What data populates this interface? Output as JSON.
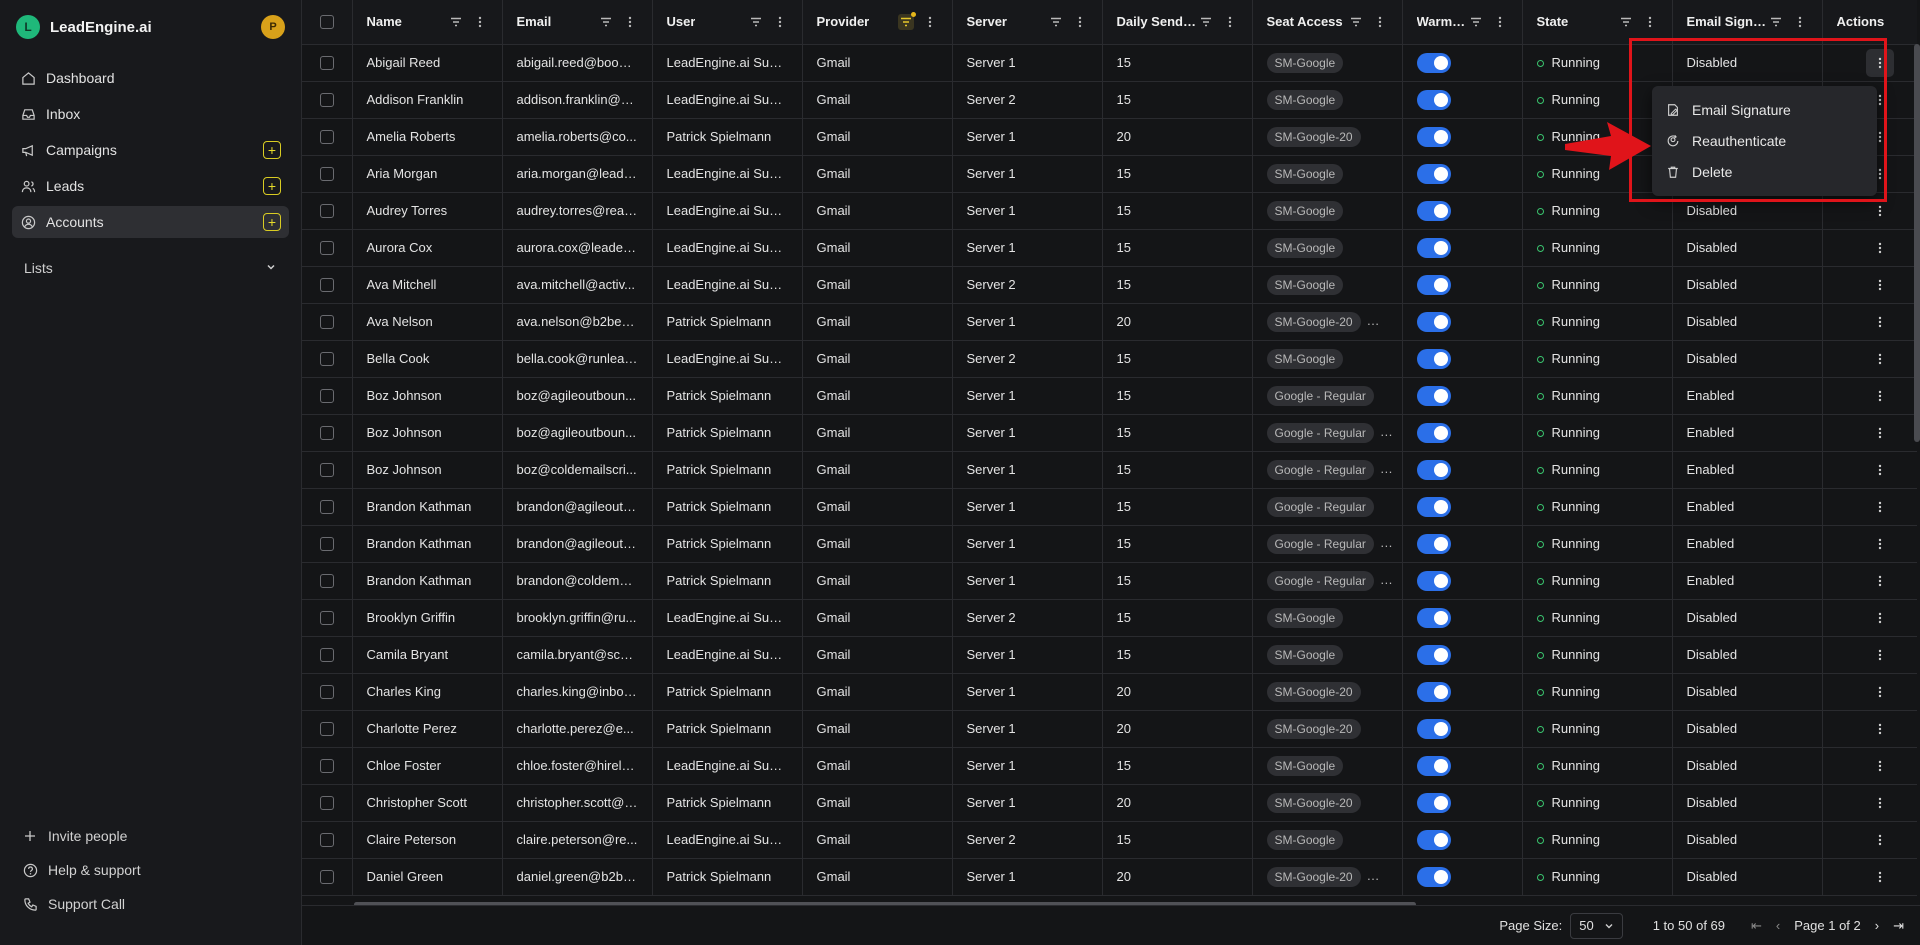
{
  "app": {
    "name": "LeadEngine.ai",
    "logo_letter": "L",
    "user_initial": "P"
  },
  "sidebar": {
    "items": [
      {
        "label": "Dashboard",
        "icon": "home-icon",
        "active": false,
        "plus": false
      },
      {
        "label": "Inbox",
        "icon": "inbox-icon",
        "active": false,
        "plus": false
      },
      {
        "label": "Campaigns",
        "icon": "megaphone-icon",
        "active": false,
        "plus": true
      },
      {
        "label": "Leads",
        "icon": "users-icon",
        "active": false,
        "plus": true
      },
      {
        "label": "Accounts",
        "icon": "account-icon",
        "active": true,
        "plus": true
      }
    ],
    "lists_label": "Lists",
    "bottom": [
      {
        "label": "Invite people",
        "icon": "plus-icon"
      },
      {
        "label": "Help & support",
        "icon": "help-icon"
      },
      {
        "label": "Support Call",
        "icon": "phone-icon"
      }
    ]
  },
  "table": {
    "columns": [
      "Name",
      "Email",
      "User",
      "Provider",
      "Server",
      "Daily Send Li...",
      "Seat Access",
      "WarmUp",
      "State",
      "Email Signat...",
      "Actions"
    ],
    "rows": [
      [
        "Abigail Reed",
        "abigail.reed@boost...",
        "LeadEngine.ai Supp...",
        "Gmail",
        "Server 1",
        "15",
        [
          "SM-Google"
        ],
        "Running",
        "Disabled"
      ],
      [
        "Addison Franklin",
        "addison.franklin@u...",
        "LeadEngine.ai Supp...",
        "Gmail",
        "Server 2",
        "15",
        [
          "SM-Google"
        ],
        "Running",
        "Disabled"
      ],
      [
        "Amelia Roberts",
        "amelia.roberts@co...",
        "Patrick Spielmann",
        "Gmail",
        "Server 1",
        "20",
        [
          "SM-Google-20"
        ],
        "Running",
        "Disabled"
      ],
      [
        "Aria Morgan",
        "aria.morgan@leade...",
        "LeadEngine.ai Supp...",
        "Gmail",
        "Server 1",
        "15",
        [
          "SM-Google"
        ],
        "Running",
        "Disabled"
      ],
      [
        "Audrey Torres",
        "audrey.torres@reac...",
        "LeadEngine.ai Supp...",
        "Gmail",
        "Server 1",
        "15",
        [
          "SM-Google"
        ],
        "Running",
        "Disabled"
      ],
      [
        "Aurora Cox",
        "aurora.cox@leaden...",
        "LeadEngine.ai Supp...",
        "Gmail",
        "Server 1",
        "15",
        [
          "SM-Google"
        ],
        "Running",
        "Disabled"
      ],
      [
        "Ava Mitchell",
        "ava.mitchell@activ...",
        "LeadEngine.ai Supp...",
        "Gmail",
        "Server 2",
        "15",
        [
          "SM-Google"
        ],
        "Running",
        "Disabled"
      ],
      [
        "Ava Nelson",
        "ava.nelson@b2bem...",
        "Patrick Spielmann",
        "Gmail",
        "Server 1",
        "20",
        [
          "SM-Google-20",
          "Hig"
        ],
        "Running",
        "Disabled"
      ],
      [
        "Bella Cook",
        "bella.cook@runlead...",
        "LeadEngine.ai Supp...",
        "Gmail",
        "Server 2",
        "15",
        [
          "SM-Google"
        ],
        "Running",
        "Disabled"
      ],
      [
        "Boz Johnson",
        "boz@agileoutboun...",
        "Patrick Spielmann",
        "Gmail",
        "Server 1",
        "15",
        [
          "Google - Regular"
        ],
        "Running",
        "Enabled"
      ],
      [
        "Boz Johnson",
        "boz@agileoutboun...",
        "Patrick Spielmann",
        "Gmail",
        "Server 1",
        "15",
        [
          "Google - Regular",
          "H"
        ],
        "Running",
        "Enabled"
      ],
      [
        "Boz Johnson",
        "boz@coldemailscri...",
        "Patrick Spielmann",
        "Gmail",
        "Server 1",
        "15",
        [
          "Google - Regular",
          "H"
        ],
        "Running",
        "Enabled"
      ],
      [
        "Brandon Kathman",
        "brandon@agileoutb...",
        "Patrick Spielmann",
        "Gmail",
        "Server 1",
        "15",
        [
          "Google - Regular"
        ],
        "Running",
        "Enabled"
      ],
      [
        "Brandon Kathman",
        "brandon@agileoutb...",
        "Patrick Spielmann",
        "Gmail",
        "Server 1",
        "15",
        [
          "Google - Regular",
          "H"
        ],
        "Running",
        "Enabled"
      ],
      [
        "Brandon Kathman",
        "brandon@coldemai...",
        "Patrick Spielmann",
        "Gmail",
        "Server 1",
        "15",
        [
          "Google - Regular",
          "H"
        ],
        "Running",
        "Enabled"
      ],
      [
        "Brooklyn Griffin",
        "brooklyn.griffin@ru...",
        "LeadEngine.ai Supp...",
        "Gmail",
        "Server 2",
        "15",
        [
          "SM-Google"
        ],
        "Running",
        "Disabled"
      ],
      [
        "Camila Bryant",
        "camila.bryant@scal...",
        "LeadEngine.ai Supp...",
        "Gmail",
        "Server 1",
        "15",
        [
          "SM-Google"
        ],
        "Running",
        "Disabled"
      ],
      [
        "Charles King",
        "charles.king@inbox...",
        "Patrick Spielmann",
        "Gmail",
        "Server 1",
        "20",
        [
          "SM-Google-20"
        ],
        "Running",
        "Disabled"
      ],
      [
        "Charlotte Perez",
        "charlotte.perez@e...",
        "Patrick Spielmann",
        "Gmail",
        "Server 1",
        "20",
        [
          "SM-Google-20"
        ],
        "Running",
        "Disabled"
      ],
      [
        "Chloe Foster",
        "chloe.foster@hirele...",
        "LeadEngine.ai Supp...",
        "Gmail",
        "Server 1",
        "15",
        [
          "SM-Google"
        ],
        "Running",
        "Disabled"
      ],
      [
        "Christopher Scott",
        "christopher.scott@r...",
        "Patrick Spielmann",
        "Gmail",
        "Server 1",
        "20",
        [
          "SM-Google-20"
        ],
        "Running",
        "Disabled"
      ],
      [
        "Claire Peterson",
        "claire.peterson@re...",
        "LeadEngine.ai Supp...",
        "Gmail",
        "Server 2",
        "15",
        [
          "SM-Google"
        ],
        "Running",
        "Disabled"
      ],
      [
        "Daniel Green",
        "daniel.green@b2be...",
        "Patrick Spielmann",
        "Gmail",
        "Server 1",
        "20",
        [
          "SM-Google-20",
          "Hig"
        ],
        "Running",
        "Disabled"
      ]
    ]
  },
  "menu": {
    "items": [
      {
        "label": "Email Signature",
        "icon": "signature-icon"
      },
      {
        "label": "Reauthenticate",
        "icon": "reauth-icon"
      },
      {
        "label": "Delete",
        "icon": "trash-icon"
      }
    ]
  },
  "footer": {
    "page_size_label": "Page Size:",
    "page_size_value": "50",
    "range": "1 to 50 of 69",
    "page_label": "Page 1 of 2"
  },
  "colors": {
    "accent_blue": "#2b6fe8",
    "running_green": "#3ac46e",
    "brand_green": "#1fb87a",
    "plus_yellow": "#d9cc23",
    "annotation_red": "#e0141a"
  }
}
